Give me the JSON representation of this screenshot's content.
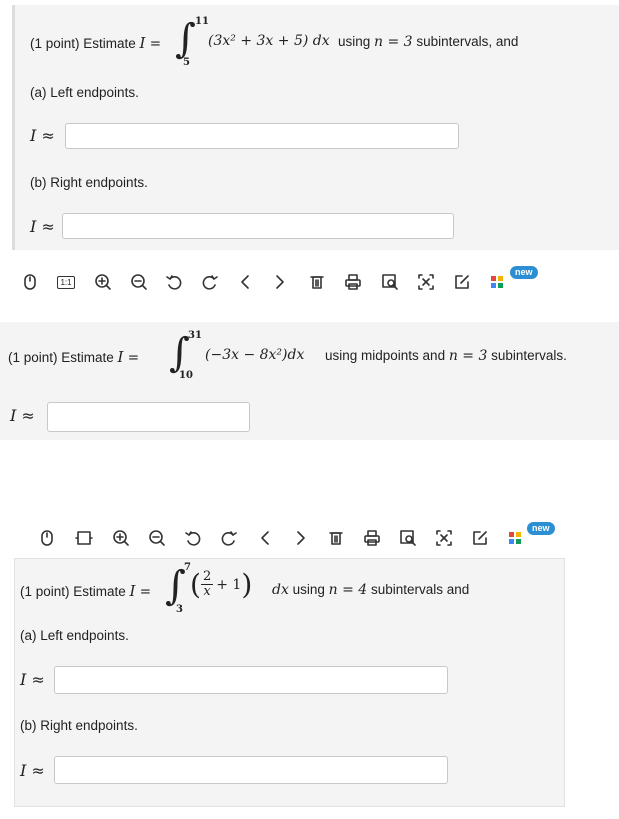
{
  "problem1": {
    "prefix": "(1 point) Estimate ",
    "var": "I",
    "eq": " = ",
    "lower": "5",
    "upper": "11",
    "integrand": "(3x² + 3x + 5) dx",
    "suffix_pre": " using ",
    "n_expr": "n = 3",
    "suffix": " subintervals, and",
    "part_a": "(a) Left endpoints.",
    "part_b": "(b) Right endpoints.",
    "approx_label": "I ≈",
    "answer_a": "",
    "answer_b": ""
  },
  "problem2": {
    "prefix": "(1 point) Estimate ",
    "var": "I",
    "eq": " = ",
    "lower": "10",
    "upper": "31",
    "integrand": "(−3x − 8x²)dx",
    "suffix_pre": " using midpoints and ",
    "n_expr": "n = 3",
    "suffix": " subintervals.",
    "approx_label": "I ≈",
    "answer": ""
  },
  "problem3": {
    "prefix": "(1 point) Estimate ",
    "var": "I",
    "eq": " = ",
    "lower": "3",
    "upper": "7",
    "frac_num": "2",
    "frac_den": "x",
    "plus_one": "+ 1",
    "dx": "dx",
    "suffix_pre": " using ",
    "n_expr": "n = 4",
    "suffix": " subintervals and",
    "part_a": "(a) Left endpoints.",
    "part_b": "(b) Right endpoints.",
    "approx_label": "I ≈",
    "answer_a": "",
    "answer_b": ""
  },
  "toolbar1": {
    "items": [
      "mouse-icon",
      "actual-size-icon",
      "zoom-in-icon",
      "zoom-out-icon",
      "rotate-left-icon",
      "rotate-right-icon",
      "previous-icon",
      "next-icon",
      "delete-icon",
      "print-icon",
      "image-search-icon",
      "translate-icon",
      "edit-icon",
      "apps-icon"
    ],
    "actual_size_text": "1:1",
    "badge": "new"
  },
  "toolbar2": {
    "badge": "new"
  },
  "colors": {
    "panel": "#f4f4f4",
    "border": "#c8c8c8",
    "badge": "#2d8fd3"
  }
}
